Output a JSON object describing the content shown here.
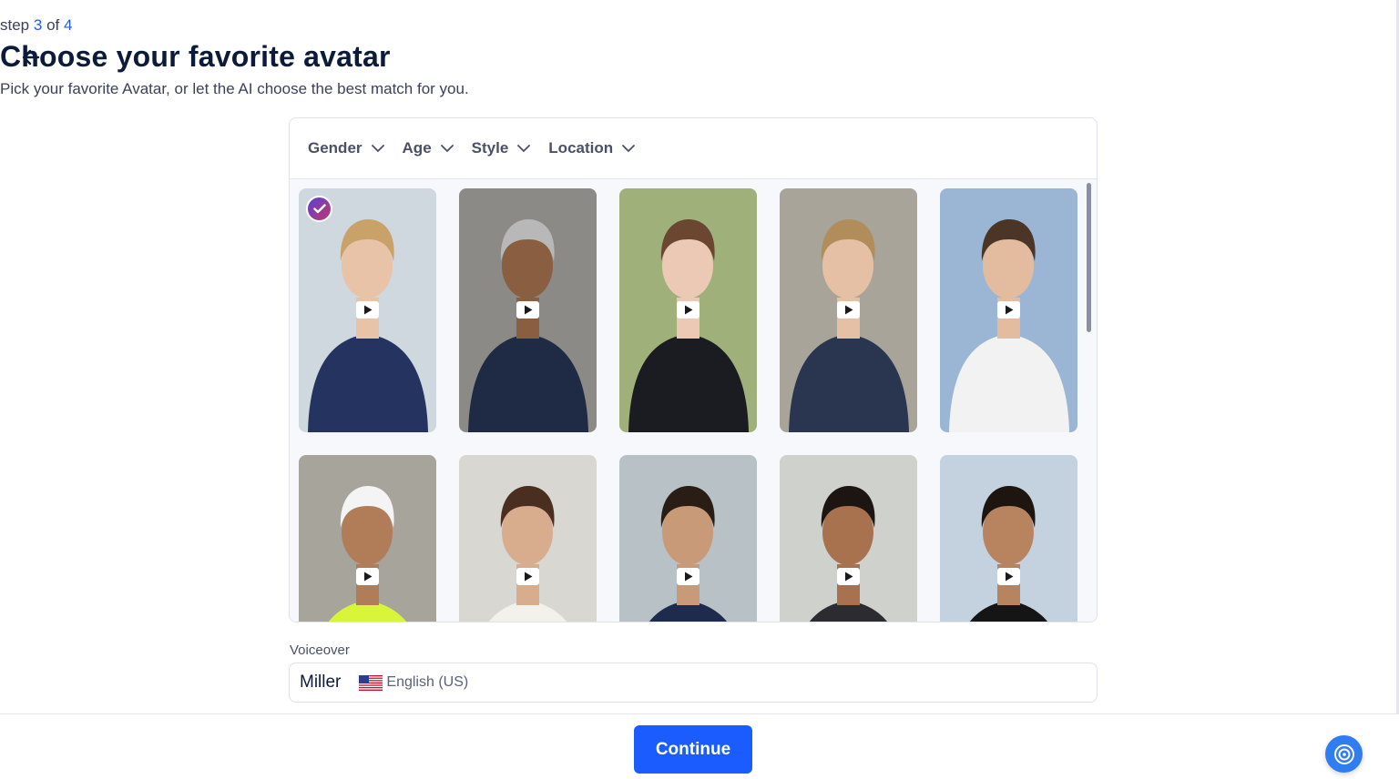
{
  "header": {
    "step_prefix": "step",
    "step_current": "3",
    "step_of": "of",
    "step_total": "4",
    "title": "Choose your favorite avatar",
    "subtitle": "Pick your favorite Avatar, or let the AI choose the best match for you."
  },
  "filters": [
    {
      "label": "Gender"
    },
    {
      "label": "Age"
    },
    {
      "label": "Style"
    },
    {
      "label": "Location"
    }
  ],
  "avatars": [
    {
      "bg": "#cfd8df",
      "skin": "#e8c3a8",
      "hair": "#c9a26a",
      "shirt": "#24335f",
      "selected": true
    },
    {
      "bg": "#8c8a86",
      "skin": "#8a5e40",
      "hair": "#b8b8b8",
      "shirt": "#1f2a44",
      "selected": false
    },
    {
      "bg": "#9fb07a",
      "skin": "#ecc9b4",
      "hair": "#6b4631",
      "shirt": "#1b1b22",
      "selected": false
    },
    {
      "bg": "#a8a49a",
      "skin": "#e5c0a4",
      "hair": "#b08d5a",
      "shirt": "#2a3550",
      "selected": false
    },
    {
      "bg": "#9ab6d4",
      "skin": "#e3bca0",
      "hair": "#4a3526",
      "shirt": "#f2f2f2",
      "selected": false
    },
    {
      "bg": "#a7a49c",
      "skin": "#b07d58",
      "hair": "#f4f4f4",
      "shirt": "#d9f53a",
      "selected": false
    },
    {
      "bg": "#d9d7d2",
      "skin": "#d8ad8e",
      "hair": "#4a2f20",
      "shirt": "#f3f1ec",
      "selected": false
    },
    {
      "bg": "#b8c2c6",
      "skin": "#c99a78",
      "hair": "#2a1d16",
      "shirt": "#1f2b4d",
      "selected": false
    },
    {
      "bg": "#cfd1cc",
      "skin": "#a8724e",
      "hair": "#1c1512",
      "shirt": "#2b2b30",
      "selected": false
    },
    {
      "bg": "#c4d2df",
      "skin": "#b88460",
      "hair": "#1e1510",
      "shirt": "#151515",
      "selected": false
    }
  ],
  "voiceover": {
    "label": "Voiceover",
    "name": "Miller",
    "language": "English (US)",
    "flag": "us-flag-icon"
  },
  "footer": {
    "continue_label": "Continue"
  },
  "colors": {
    "accent": "#1a5cff",
    "step_highlight": "#1f5fe8",
    "help_button": "#2f7df0"
  }
}
